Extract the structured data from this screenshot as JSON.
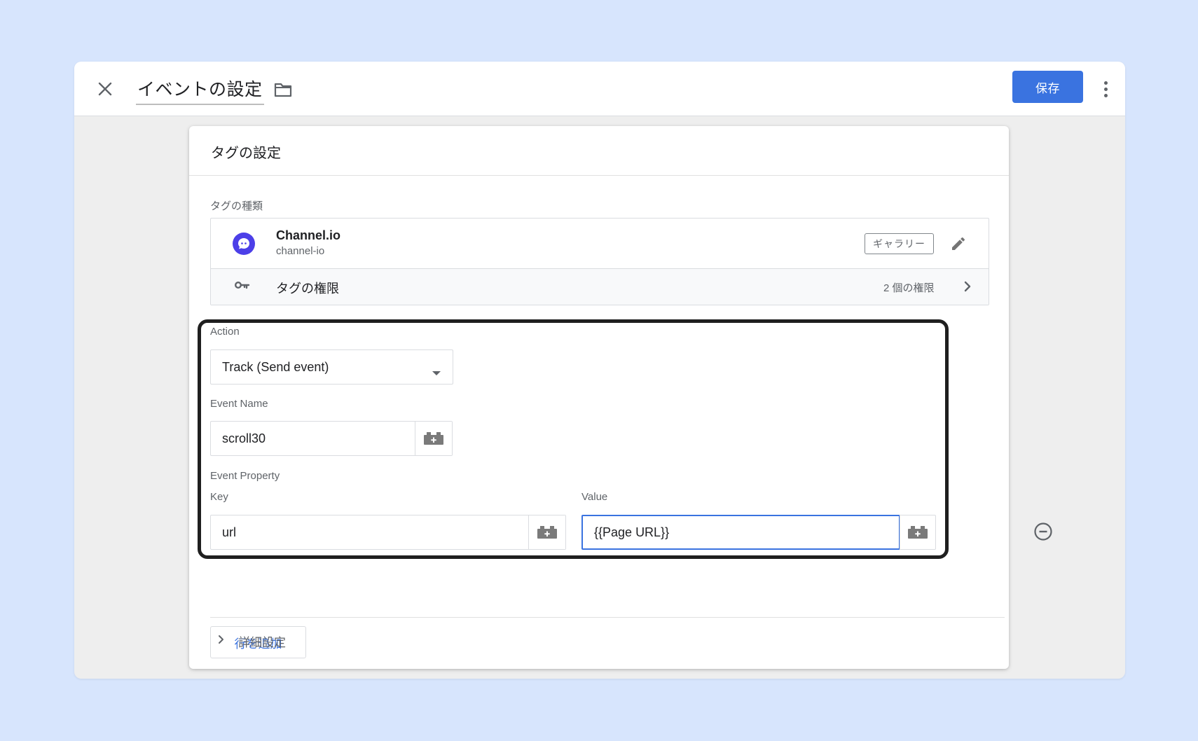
{
  "header": {
    "title": "イベントの設定",
    "save_label": "保存"
  },
  "card": {
    "title": "タグの設定",
    "tag_type_label": "タグの種類",
    "tag_name": "Channel.io",
    "tag_id": "channel-io",
    "gallery_badge": "ギャラリー",
    "permissions_label": "タグの権限",
    "permissions_count": "2 個の権限"
  },
  "fields": {
    "action_label": "Action",
    "action_value": "Track (Send event)",
    "event_name_label": "Event Name",
    "event_name_value": "scroll30",
    "event_property_label": "Event Property",
    "key_label": "Key",
    "key_value": "url",
    "value_label": "Value",
    "value_value": "{{Page URL}}"
  },
  "add_row_label": "行を追加",
  "advanced_label": "詳細設定",
  "colors": {
    "background": "#d7e5fd",
    "accent": "#3a73e0",
    "channel_logo": "#4c3fe8"
  },
  "icons": [
    "close-icon",
    "folder-icon",
    "more-vert-icon",
    "channel-logo-icon",
    "pencil-icon",
    "key-icon",
    "chevron-right-icon",
    "dropdown-arrow-icon",
    "variable-icon",
    "remove-circle-icon"
  ]
}
